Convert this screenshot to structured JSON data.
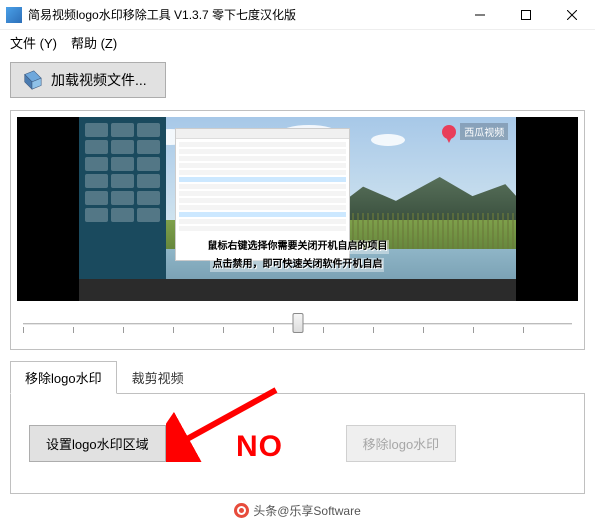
{
  "window": {
    "title": "简易视频logo水印移除工具 V1.3.7 零下七度汉化版"
  },
  "menubar": {
    "file": "文件 (Y)",
    "help": "帮助 (Z)"
  },
  "toolbar": {
    "load_video_label": "加载视频文件..."
  },
  "preview": {
    "watermark_text": "西瓜视频",
    "subtitle_line1": "鼠标右键选择你需要关闭开机自启的项目",
    "subtitle_line2": "点击禁用，即可快速关闭软件开机自启"
  },
  "slider": {
    "position_percent": 50
  },
  "tabs": {
    "remove_watermark": "移除logo水印",
    "crop_video": "裁剪视频"
  },
  "actions": {
    "set_area_label": "设置logo水印区域",
    "remove_label": "移除logo水印"
  },
  "annotation": {
    "text": "NO",
    "color": "#ff0000"
  },
  "attribution": {
    "text": "头条@乐享Software"
  }
}
